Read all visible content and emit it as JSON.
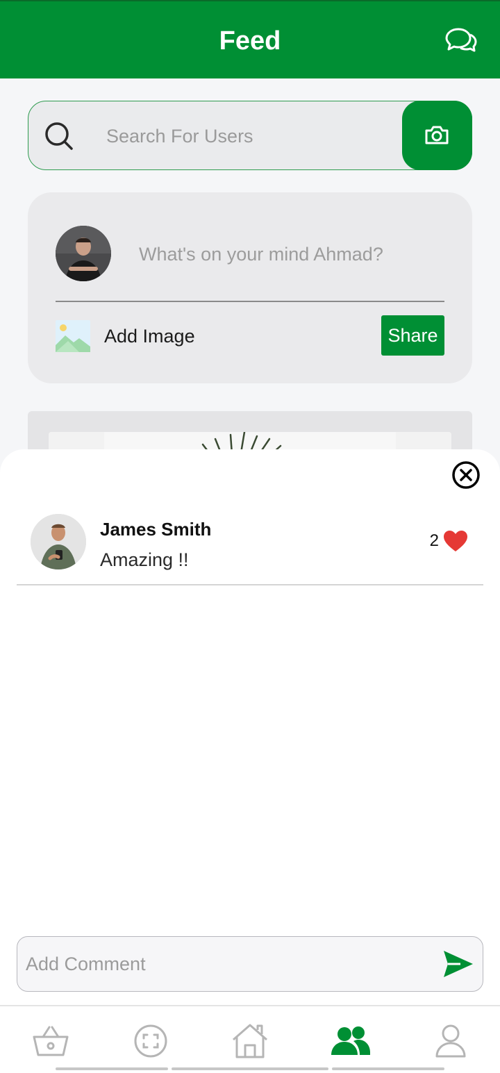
{
  "header": {
    "title": "Feed"
  },
  "search": {
    "placeholder": "Search For Users"
  },
  "composer": {
    "prompt": "What's on your mind Ahmad?",
    "add_image_label": "Add Image",
    "share_label": "Share"
  },
  "comments": {
    "items": [
      {
        "author": "James Smith",
        "text": "Amazing !!",
        "likes": "2"
      }
    ],
    "input_placeholder": "Add Comment"
  },
  "bottom_nav": {
    "items": [
      "basket-icon",
      "scan-icon",
      "home-icon",
      "friends-icon",
      "profile-icon"
    ],
    "active": "friends-icon"
  },
  "colors": {
    "brand_green": "#008f34",
    "heart_red": "#e53935"
  }
}
